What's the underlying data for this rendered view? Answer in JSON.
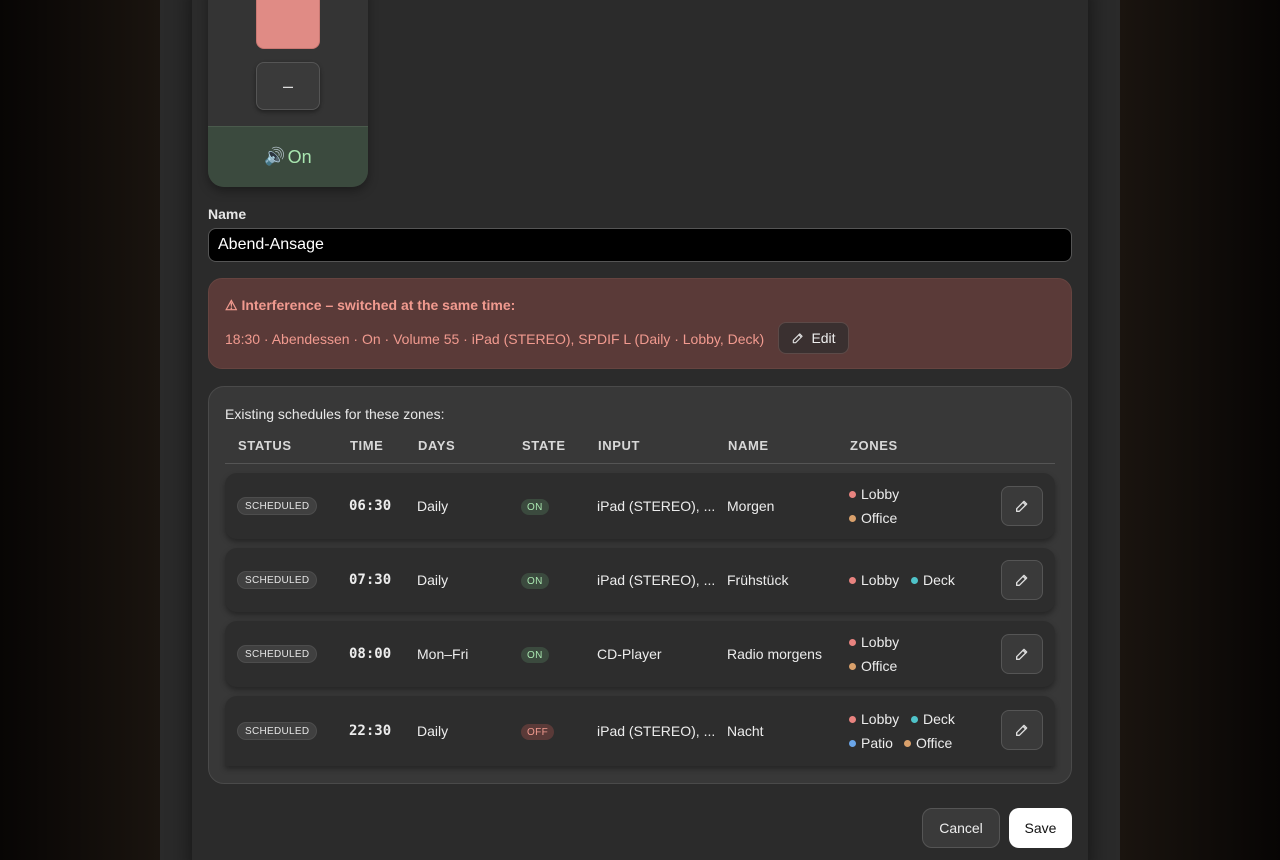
{
  "volume": {
    "minus_label": "–",
    "mute_label": "On",
    "icon": "speaker-icon"
  },
  "name_field": {
    "label": "Name",
    "value": "Abend-Ansage"
  },
  "interference": {
    "icon": "warning-icon",
    "title": "⚠ Interference – switched at the same time:",
    "detail": "18:30 · Abendessen · On · Volume 55 · iPad (STEREO), SPDIF L (Daily · Lobby, Deck)",
    "edit_label": "Edit"
  },
  "schedules": {
    "title": "Existing schedules for these zones:",
    "columns": [
      "STATUS",
      "TIME",
      "DAYS",
      "STATE",
      "INPUT",
      "NAME",
      "ZONES"
    ],
    "rows": [
      {
        "status": "SCHEDULED",
        "time": "06:30",
        "days": "Daily",
        "state": "ON",
        "input": "iPad (STEREO), ...",
        "name": "Morgen",
        "zones": [
          "Lobby",
          "Office"
        ]
      },
      {
        "status": "SCHEDULED",
        "time": "07:30",
        "days": "Daily",
        "state": "ON",
        "input": "iPad (STEREO), ...",
        "name": "Frühstück",
        "zones": [
          "Lobby",
          "Deck"
        ]
      },
      {
        "status": "SCHEDULED",
        "time": "08:00",
        "days": "Mon–Fri",
        "state": "ON",
        "input": "CD-Player",
        "name": "Radio morgens",
        "zones": [
          "Lobby",
          "Office"
        ]
      },
      {
        "status": "SCHEDULED",
        "time": "22:30",
        "days": "Daily",
        "state": "OFF",
        "input": "iPad (STEREO), ...",
        "name": "Nacht",
        "zones": [
          "Lobby",
          "Deck",
          "Patio",
          "Office"
        ]
      }
    ]
  },
  "zone_colors": {
    "Lobby": "#e8837f",
    "Office": "#d9a06b",
    "Deck": "#4fc3c9",
    "Patio": "#6aa5e8"
  },
  "footer": {
    "cancel_label": "Cancel",
    "save_label": "Save"
  }
}
